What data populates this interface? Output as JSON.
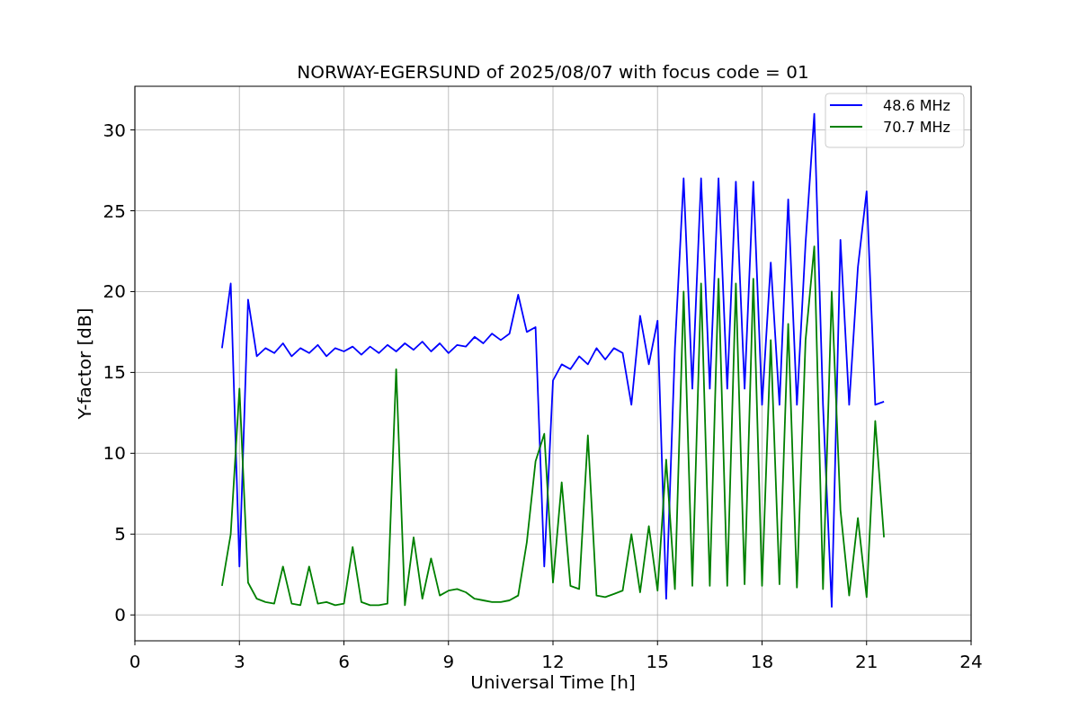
{
  "chart_data": {
    "type": "line",
    "title": "NORWAY-EGERSUND of 2025/08/07 with focus code = 01",
    "xlabel": "Universal Time [h]",
    "ylabel": "Y-factor [dB]",
    "x": [
      2.5,
      2.75,
      3,
      3.25,
      3.5,
      3.75,
      4,
      4.25,
      4.5,
      4.75,
      5,
      5.25,
      5.5,
      5.75,
      6,
      6.25,
      6.5,
      6.75,
      7,
      7.25,
      7.5,
      7.75,
      8,
      8.25,
      8.5,
      8.75,
      9,
      9.25,
      9.5,
      9.75,
      10,
      10.25,
      10.5,
      10.75,
      11,
      11.25,
      11.5,
      11.75,
      12,
      12.25,
      12.5,
      12.75,
      13,
      13.25,
      13.5,
      13.75,
      14,
      14.25,
      14.5,
      14.75,
      15,
      15.25,
      15.5,
      15.75,
      16,
      16.25,
      16.5,
      16.75,
      17,
      17.25,
      17.5,
      17.75,
      18,
      18.25,
      18.5,
      18.75,
      19,
      19.25,
      19.5,
      19.75,
      20,
      20.25,
      20.5,
      20.75,
      21,
      21.25,
      21.5
    ],
    "series": [
      {
        "name": "48.6 MHz",
        "color": "#0000ff",
        "values": [
          16.5,
          20.5,
          3,
          19.5,
          16,
          16.5,
          16.2,
          16.8,
          16,
          16.5,
          16.2,
          16.7,
          16,
          16.5,
          16.3,
          16.6,
          16.1,
          16.6,
          16.2,
          16.7,
          16.3,
          16.8,
          16.4,
          16.9,
          16.3,
          16.8,
          16.2,
          16.7,
          16.6,
          17.2,
          16.8,
          17.4,
          17,
          17.4,
          19.8,
          17.5,
          17.8,
          3,
          14.5,
          15.5,
          15.2,
          16,
          15.5,
          16.5,
          15.8,
          16.5,
          16.2,
          13,
          18.5,
          15.5,
          18.2,
          1,
          16.5,
          27,
          14,
          27,
          14,
          27,
          14,
          26.8,
          14,
          26.8,
          13,
          21.8,
          13,
          25.7,
          13,
          23,
          31,
          13,
          0.5,
          23.2,
          13,
          21.5,
          26.2,
          13,
          13.2
        ]
      },
      {
        "name": "70.7 MHz",
        "color": "#008000",
        "values": [
          1.8,
          5,
          14,
          2,
          1,
          0.8,
          0.7,
          3,
          0.7,
          0.6,
          3,
          0.7,
          0.8,
          0.6,
          0.7,
          4.2,
          0.8,
          0.6,
          0.6,
          0.7,
          15.2,
          0.6,
          4.8,
          1,
          3.5,
          1.2,
          1.5,
          1.6,
          1.4,
          1,
          0.9,
          0.8,
          0.8,
          0.9,
          1.2,
          4.5,
          9.5,
          11.2,
          2,
          8.2,
          1.8,
          1.6,
          11.1,
          1.2,
          1.1,
          1.3,
          1.5,
          5,
          1.4,
          5.5,
          1.5,
          9.6,
          1.6,
          20,
          1.8,
          20.5,
          1.8,
          20.8,
          1.8,
          20.5,
          1.9,
          20.8,
          1.8,
          17,
          1.9,
          18,
          1.7,
          17,
          22.8,
          1.6,
          20,
          6.5,
          1.2,
          6,
          1.1,
          12,
          4.8
        ]
      }
    ],
    "grid": true,
    "legend": true,
    "xlim": [
      0,
      24
    ],
    "ylim": [
      -1.6,
      32.7
    ],
    "xticks": [
      0,
      3,
      6,
      9,
      12,
      15,
      18,
      21,
      24
    ],
    "yticks": [
      0,
      5,
      10,
      15,
      20,
      25,
      30
    ]
  }
}
